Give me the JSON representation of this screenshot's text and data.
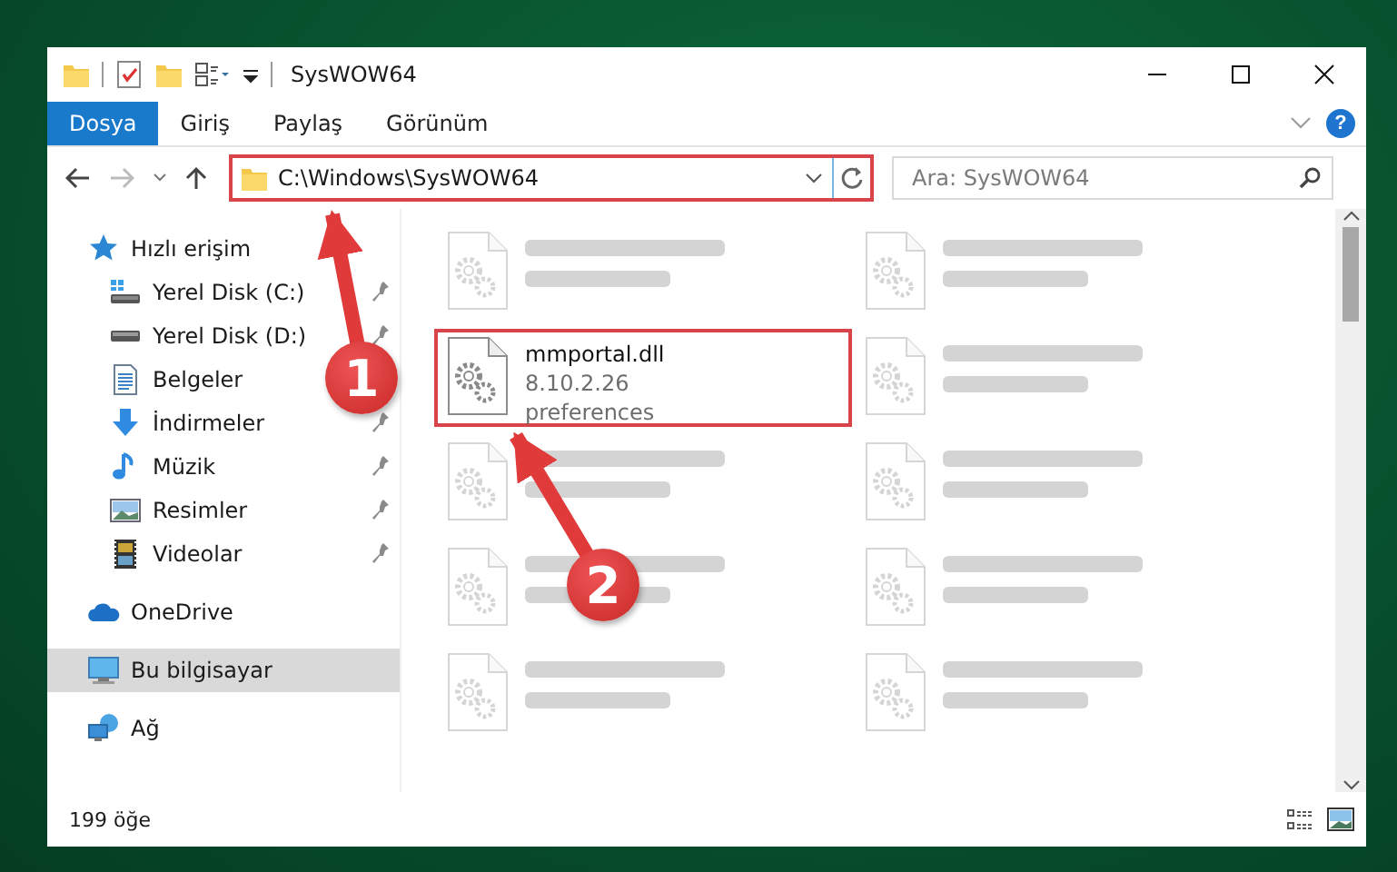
{
  "window": {
    "title": "SysWOW64"
  },
  "ribbon_tabs": [
    {
      "label": "Dosya",
      "selected": true
    },
    {
      "label": "Giriş",
      "selected": false
    },
    {
      "label": "Paylaş",
      "selected": false
    },
    {
      "label": "Görünüm",
      "selected": false
    }
  ],
  "help_button": "?",
  "address_bar": {
    "path": "C:\\Windows\\SysWOW64",
    "highlighted": true
  },
  "search": {
    "placeholder": "Ara: SysWOW64"
  },
  "sidebar": {
    "items": [
      {
        "label": "Hızlı erişim",
        "kind": "quick-access",
        "selected": false,
        "children": [
          {
            "label": "Yerel Disk (C:)",
            "kind": "system-drive",
            "pinned": true,
            "selected": false
          },
          {
            "label": "Yerel Disk (D:)",
            "kind": "drive",
            "pinned": true,
            "selected": false
          },
          {
            "label": "Belgeler",
            "kind": "documents",
            "selected": false
          },
          {
            "label": "İndirmeler",
            "kind": "downloads",
            "pinned": true,
            "selected": false
          },
          {
            "label": "Müzik",
            "kind": "music",
            "pinned": true,
            "selected": false
          },
          {
            "label": "Resimler",
            "kind": "pictures",
            "pinned": true,
            "selected": false
          },
          {
            "label": "Videolar",
            "kind": "videos",
            "pinned": true,
            "selected": false
          }
        ]
      },
      {
        "label": "OneDrive",
        "kind": "cloud",
        "selected": false
      },
      {
        "label": "Bu bilgisayar",
        "kind": "computer",
        "selected": true
      },
      {
        "label": "Ağ",
        "kind": "network",
        "selected": false
      }
    ]
  },
  "files": [
    {
      "kind": "blurred"
    },
    {
      "kind": "blurred"
    },
    {
      "kind": "file",
      "name": "mmportal.dll",
      "lines": [
        "8.10.2.26",
        "preferences"
      ],
      "highlighted": true
    },
    {
      "kind": "blurred"
    },
    {
      "kind": "blurred"
    },
    {
      "kind": "blurred"
    },
    {
      "kind": "blurred"
    },
    {
      "kind": "blurred"
    },
    {
      "kind": "blurred"
    },
    {
      "kind": "blurred"
    }
  ],
  "status_bar": {
    "item_count": "199 öğe"
  },
  "annotations": [
    {
      "kind": "address-callout",
      "label": "1"
    },
    {
      "kind": "file-callout",
      "label": "2"
    }
  ]
}
